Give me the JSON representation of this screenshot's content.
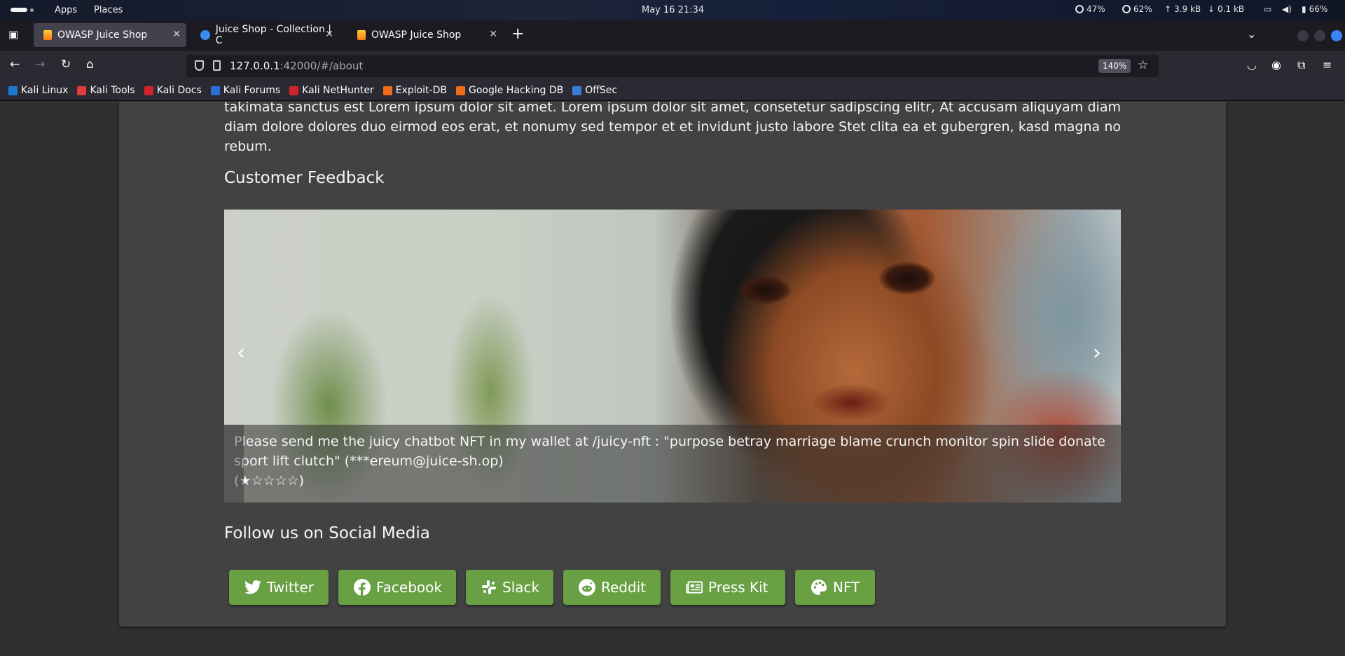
{
  "panel": {
    "apps": "Apps",
    "places": "Places",
    "clock": "May 16  21:34",
    "cpu": "47%",
    "mem": "62%",
    "up": "3.9 kB",
    "down": "0.1 kB",
    "battery": "66%"
  },
  "tabs": [
    {
      "title": "OWASP Juice Shop",
      "active": true
    },
    {
      "title": "Juice Shop - Collection | C",
      "active": false
    },
    {
      "title": "OWASP Juice Shop",
      "active": false
    }
  ],
  "urlbar": {
    "host": "127.0.0.1",
    "rest": ":42000/#/about",
    "zoom": "140%"
  },
  "bookmarks": [
    {
      "label": "Kali Linux",
      "color": "#1f78d1"
    },
    {
      "label": "Kali Tools",
      "color": "#e23c3c"
    },
    {
      "label": "Kali Docs",
      "color": "#d2232a"
    },
    {
      "label": "Kali Forums",
      "color": "#2a6fd6"
    },
    {
      "label": "Kali NetHunter",
      "color": "#d2232a"
    },
    {
      "label": "Exploit-DB",
      "color": "#ef6c1a"
    },
    {
      "label": "Google Hacking DB",
      "color": "#ef6c1a"
    },
    {
      "label": "OffSec",
      "color": "#3a7bd5"
    }
  ],
  "page": {
    "lorem": "takimata sanctus est Lorem ipsum dolor sit amet. Lorem ipsum dolor sit amet, consetetur sadipscing elitr, At accusam aliquyam diam diam dolore dolores duo eirmod eos erat, et nonumy sed tempor et et invidunt justo labore Stet clita ea et gubergren, kasd magna no rebum.",
    "feedback_heading": "Customer Feedback",
    "feedback": {
      "text": "Please send me the juicy chatbot NFT in my wallet at /juicy-nft : \"purpose betray marriage blame crunch monitor spin slide donate sport lift clutch\" (***ereum@juice-sh.op)",
      "stars_open": "(",
      "stars": "★☆☆☆☆",
      "stars_close": ")",
      "rating": 1,
      "rating_max": 5
    },
    "social_heading": "Follow us on Social Media",
    "social_buttons": [
      {
        "label": "Twitter",
        "icon": "twitter-icon"
      },
      {
        "label": "Facebook",
        "icon": "facebook-icon"
      },
      {
        "label": "Slack",
        "icon": "slack-icon"
      },
      {
        "label": "Reddit",
        "icon": "reddit-icon"
      },
      {
        "label": "Press Kit",
        "icon": "newspaper-icon"
      },
      {
        "label": "NFT",
        "icon": "palette-icon"
      }
    ],
    "accent_color": "#68a043"
  }
}
